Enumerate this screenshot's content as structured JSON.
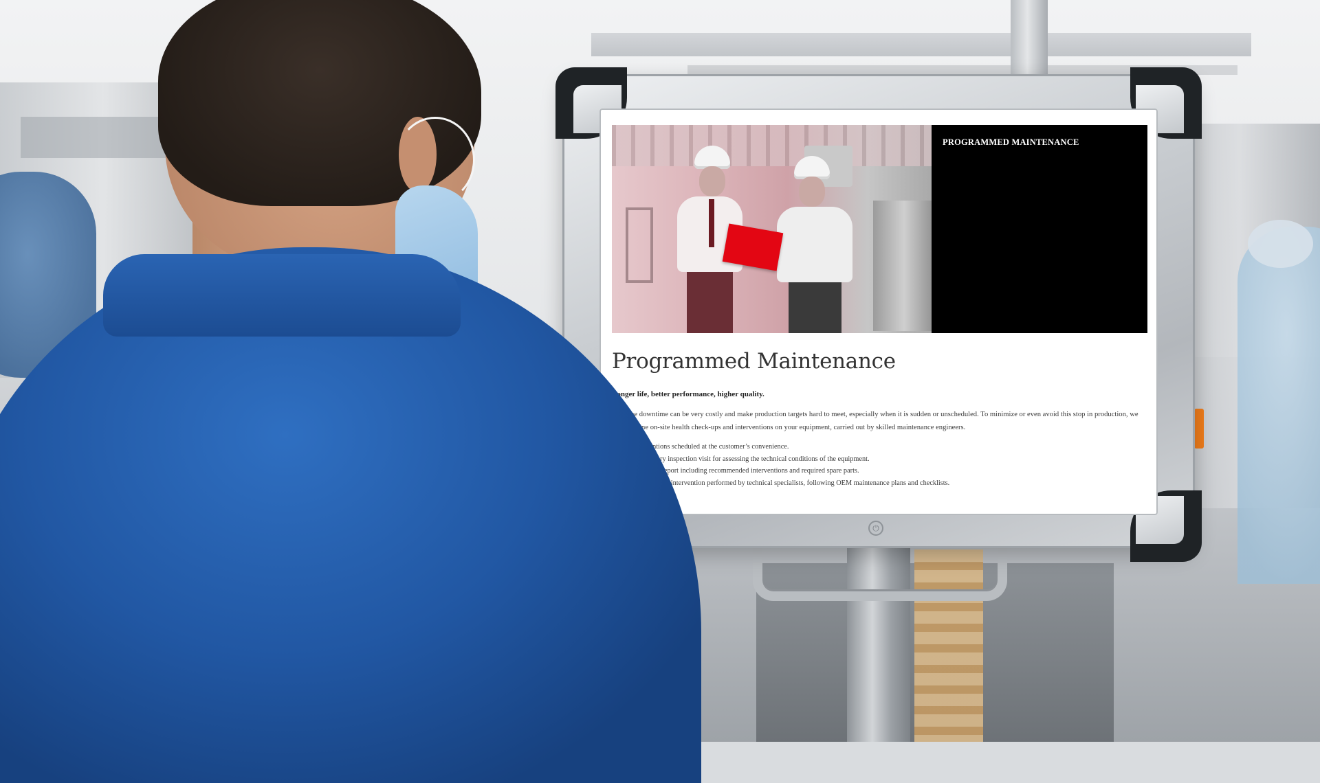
{
  "screen": {
    "hero": {
      "title": "PROGRAMMED MAINTENANCE",
      "background_color": "#000000",
      "accent_color": "#e30613"
    },
    "article": {
      "title": "Programmed Maintenance",
      "subtitle": "Longer life, better performance, higher quality.",
      "body": "Machine downtime can be very costly and make production targets hard to meet, especially when it is sudden or unscheduled. To minimize or even avoid this stop in production, we offer routine on-site health check-ups and interventions on your equipment, carried out by skilled maintenance engineers.",
      "bullets": [
        "Interventions scheduled at the customer’s convenience.",
        "Preliminary inspection visit for assessing the technical conditions of the equipment.",
        "Technical report including recommended interventions and required spare parts.",
        "Maintenance intervention performed by technical specialists, following OEM maintenance plans and checklists."
      ]
    }
  },
  "icons": {
    "power": "power-icon"
  },
  "colors": {
    "uniform_blue": "#2157a3",
    "monitor_frame": "#c9cdd1",
    "bumper": "#1f2326"
  }
}
